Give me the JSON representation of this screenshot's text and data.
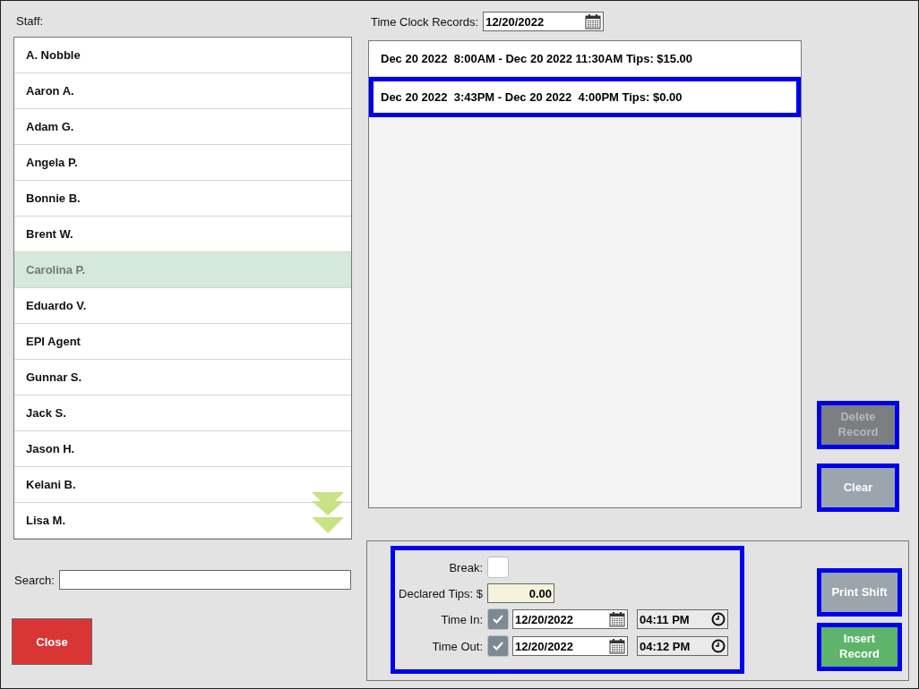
{
  "staff": {
    "label": "Staff:",
    "items": [
      {
        "name": "A. Nobble",
        "selected": false
      },
      {
        "name": "Aaron A.",
        "selected": false
      },
      {
        "name": "Adam G.",
        "selected": false
      },
      {
        "name": "Angela P.",
        "selected": false
      },
      {
        "name": "Bonnie B.",
        "selected": false
      },
      {
        "name": "Brent W.",
        "selected": false
      },
      {
        "name": "Carolina P.",
        "selected": true
      },
      {
        "name": "Eduardo V.",
        "selected": false
      },
      {
        "name": "EPI Agent",
        "selected": false
      },
      {
        "name": "Gunnar S.",
        "selected": false
      },
      {
        "name": "Jack S.",
        "selected": false
      },
      {
        "name": "Jason H.",
        "selected": false
      },
      {
        "name": "Kelani B.",
        "selected": false
      },
      {
        "name": "Lisa M.",
        "selected": false
      }
    ]
  },
  "search": {
    "label": "Search:"
  },
  "close_button": "Close",
  "time_clock": {
    "label": "Time Clock Records:",
    "date": "12/20/2022",
    "records": [
      {
        "text": "Dec 20 2022  8:00AM - Dec 20 2022 11:30AM Tips: $15.00",
        "selected": false
      },
      {
        "text": "Dec 20 2022  3:43PM - Dec 20 2022  4:00PM Tips: $0.00",
        "selected": true
      }
    ]
  },
  "side_buttons": [
    {
      "label": "Delete Record",
      "kind": "grey",
      "disabled": true
    },
    {
      "label": "Clear",
      "kind": "grey",
      "disabled": false
    }
  ],
  "form": {
    "break": {
      "label": "Break:",
      "checked": false
    },
    "tips": {
      "label": "Declared Tips: $",
      "value": "0.00"
    },
    "times": [
      {
        "label": "Time In:",
        "checked": true,
        "date": "12/20/2022",
        "time": "04:11 PM"
      },
      {
        "label": "Time Out:",
        "checked": true,
        "date": "12/20/2022",
        "time": "04:12 PM"
      }
    ]
  },
  "bottom_buttons": [
    {
      "label": "Print Shift",
      "kind": "grey",
      "disabled": false
    },
    {
      "label": "Insert Record",
      "kind": "green",
      "disabled": false
    }
  ]
}
